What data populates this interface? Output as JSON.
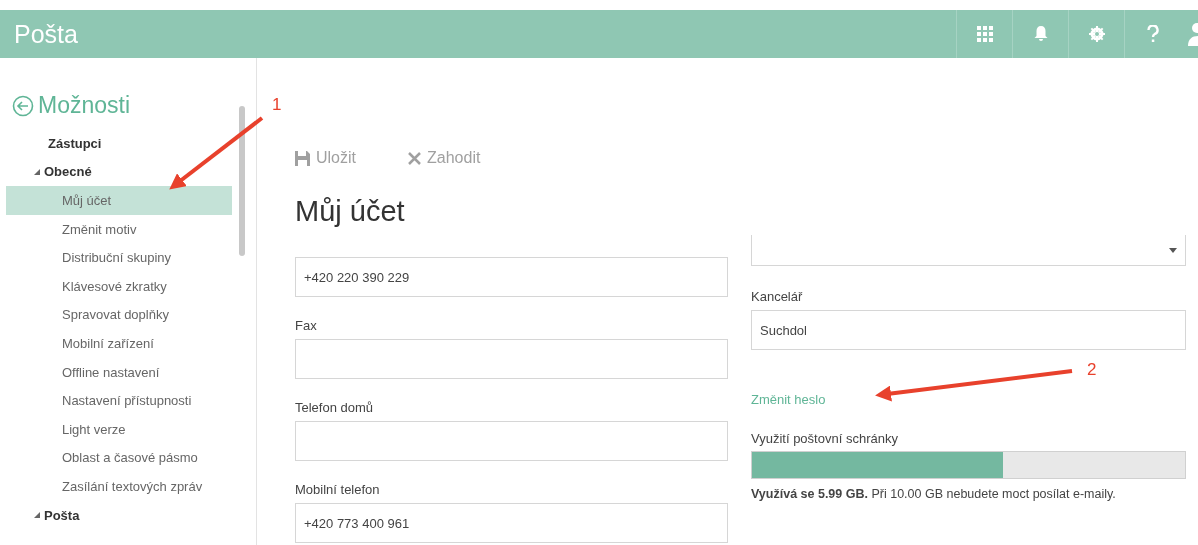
{
  "header": {
    "title": "Pošta"
  },
  "sidebar": {
    "back_title": "Možnosti",
    "items": [
      {
        "label": "Zástupci"
      },
      {
        "label": "Obecné",
        "expanded": true,
        "children": [
          {
            "label": "Můj účet",
            "selected": true
          },
          {
            "label": "Změnit motiv",
            "selected": false
          },
          {
            "label": "Distribuční skupiny",
            "selected": false
          },
          {
            "label": "Klávesové zkratky",
            "selected": false
          },
          {
            "label": "Spravovat doplňky",
            "selected": false
          },
          {
            "label": "Mobilní zařízení",
            "selected": false
          },
          {
            "label": "Offline nastavení",
            "selected": false
          },
          {
            "label": "Nastavení přístupnosti",
            "selected": false
          },
          {
            "label": "Light verze",
            "selected": false
          },
          {
            "label": "Oblast a časové pásmo",
            "selected": false
          },
          {
            "label": "Zasílání textových zpráv",
            "selected": false
          }
        ]
      },
      {
        "label": "Pošta",
        "expanded": true
      }
    ]
  },
  "toolbar": [
    {
      "kind": "save",
      "label": "Uložit",
      "disabled": true
    },
    {
      "kind": "discard",
      "label": "Zahodit",
      "disabled": true
    }
  ],
  "page_title": "Můj účet",
  "left_fields": [
    {
      "value": "+420 220 390 229"
    },
    {
      "label": "Fax"
    },
    {
      "label": "Telefon domů"
    },
    {
      "label": "Mobilní telefon",
      "value": "+420 773 400 961"
    }
  ],
  "right_fields": [
    {
      "kind": "dropdown"
    },
    {
      "kind": "text",
      "label": "Kancelář",
      "value": "Suchdol"
    }
  ],
  "change_password_link": "Změnit heslo",
  "mailbox_usage": {
    "label": "Využití poštovní schránky",
    "level": 0.58,
    "note": "**Využívá se 5.99 GB.**  Při 10.00 GB nebudete moct posílat e-maily."
  },
  "annotations": [
    {
      "label": "1"
    },
    {
      "label": "2"
    }
  ]
}
